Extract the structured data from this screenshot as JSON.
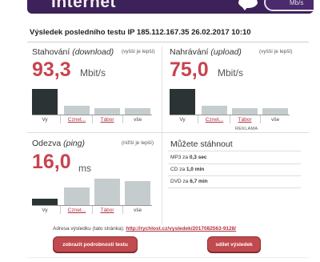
{
  "banner": {
    "title": "Internet",
    "unit": "Mb/s"
  },
  "result": {
    "header": "Výsledek posledního testu IP 185.112.167.35 26.02.2017 10:10"
  },
  "download": {
    "title_main": "Stahování",
    "title_em": "(download)",
    "hint": "(vyšší je lepší)",
    "value": "93,3",
    "unit": "Mbit/s",
    "bars": [
      {
        "label": "Vy",
        "level": 0.85,
        "style": "dark",
        "link": false
      },
      {
        "label": "Cznet...",
        "level": 0.28,
        "style": "light",
        "link": true
      },
      {
        "label": "Tábor",
        "level": 0.2,
        "style": "light",
        "link": true
      },
      {
        "label": "vše",
        "level": 0.2,
        "style": "light",
        "link": false
      }
    ]
  },
  "upload": {
    "title_main": "Nahrávání",
    "title_em": "(upload)",
    "hint": "(vyšší je lepší)",
    "value": "75,0",
    "unit": "Mbit/s",
    "bars": [
      {
        "label": "Vy",
        "level": 0.85,
        "style": "dark",
        "link": false
      },
      {
        "label": "Cznet...",
        "level": 0.28,
        "style": "light",
        "link": true
      },
      {
        "label": "Tábor",
        "level": 0.2,
        "style": "light",
        "link": true
      },
      {
        "label": "vše",
        "level": 0.2,
        "style": "light",
        "link": false
      }
    ]
  },
  "ping": {
    "title_main": "Odezva",
    "title_em": "(ping)",
    "hint": "(nižší je lepší)",
    "value": "16,0",
    "unit": "ms",
    "bars": [
      {
        "label": "Vy",
        "level": 0.2,
        "style": "dark",
        "link": false
      },
      {
        "label": "Cznet...",
        "level": 0.58,
        "style": "light",
        "link": true
      },
      {
        "label": "Tábor",
        "level": 0.86,
        "style": "light",
        "link": true
      },
      {
        "label": "vše",
        "level": 0.78,
        "style": "light",
        "link": false
      }
    ]
  },
  "ad": {
    "label": "REKLAMA"
  },
  "download_time": {
    "title": "Můžete stáhnout",
    "rows": [
      {
        "prefix": "MP3 za",
        "value": "0,3 sec"
      },
      {
        "prefix": "CD za",
        "value": "1,0 min"
      },
      {
        "prefix": "DVD za",
        "value": "6,7 min"
      }
    ]
  },
  "footer": {
    "address_label": "Adresa výsledku (tato stránka):",
    "address_url": "http://rychlost.cz/vysledek/2017082563-9128/",
    "details_button": "zobrazit podrobnosti testu",
    "share_button": "sdílet výsledek"
  },
  "colors": {
    "accent": "#c8434e",
    "banner": "#3d2159",
    "bar_dark": "#2c3335",
    "bar_light": "#c5cccd",
    "button": "#c14a4f"
  }
}
